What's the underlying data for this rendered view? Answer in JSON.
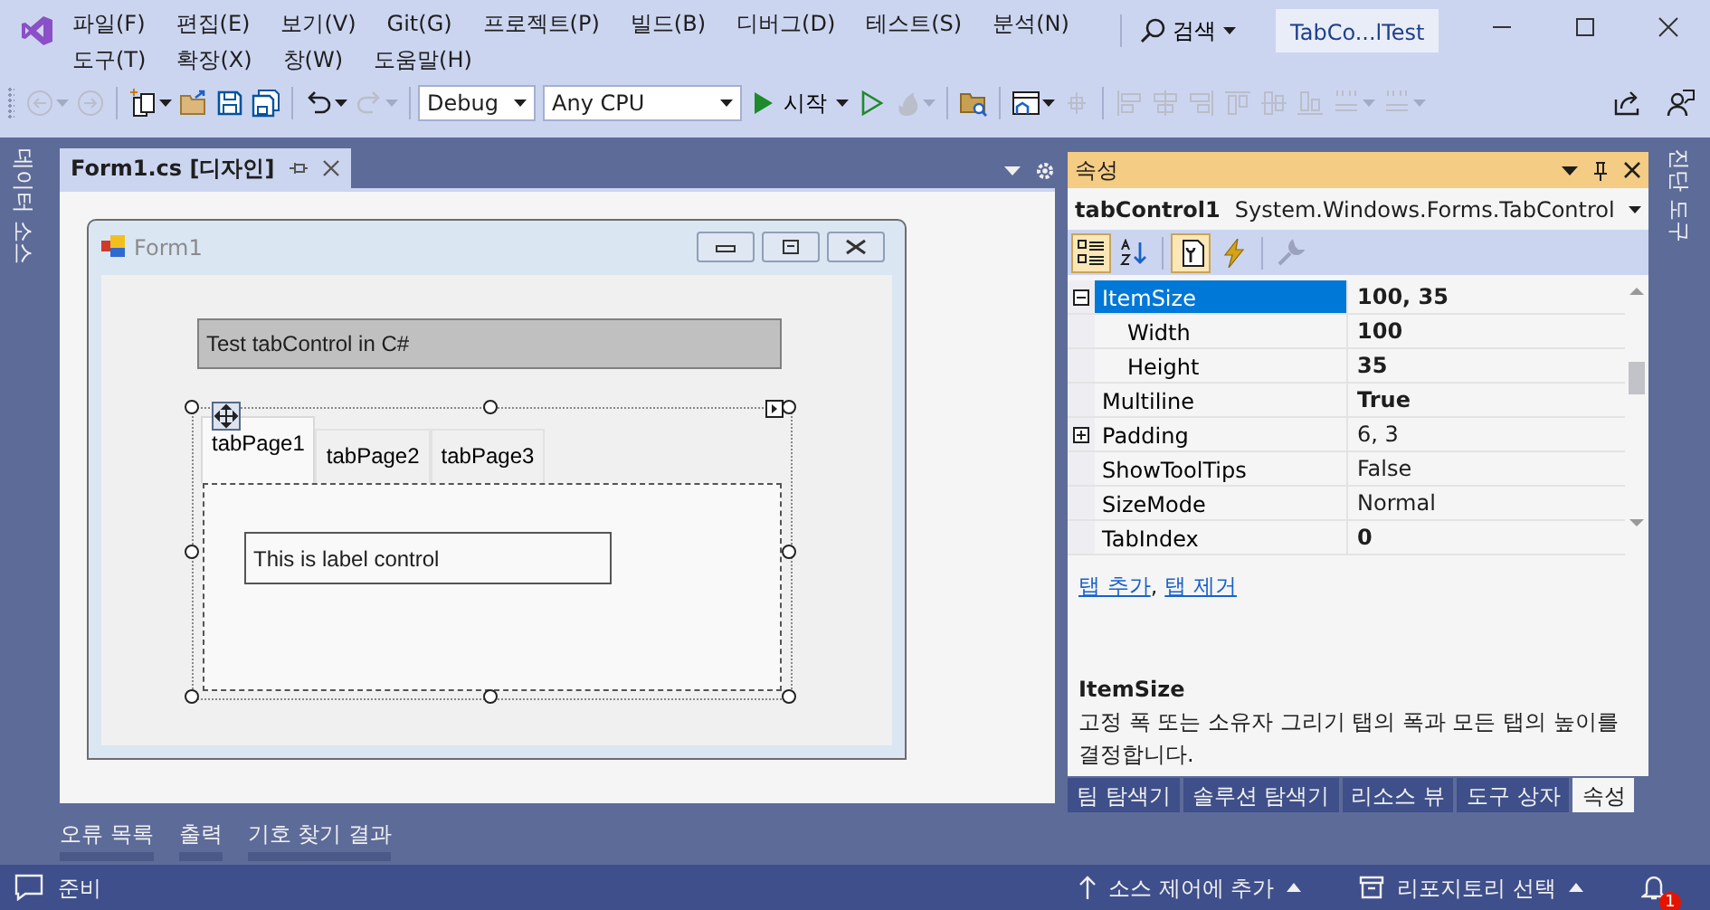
{
  "menu": [
    "파일(F)",
    "편집(E)",
    "보기(V)",
    "Git(G)",
    "프로젝트(P)",
    "빌드(B)",
    "디버그(D)",
    "테스트(S)",
    "분석(N)",
    "도구(T)",
    "확장(X)",
    "창(W)",
    "도움말(H)"
  ],
  "search": {
    "label": "검색"
  },
  "window": {
    "title": "TabCo...lTest"
  },
  "toolbar": [
    {
      "kind": "back",
      "disabled": true,
      "split": true
    },
    {
      "kind": "forward",
      "disabled": true,
      "split": false
    },
    {
      "kind": "separator"
    },
    {
      "kind": "new-project",
      "disabled": false,
      "split": true
    },
    {
      "kind": "open",
      "disabled": false,
      "split": false
    },
    {
      "kind": "save",
      "disabled": false,
      "split": false
    },
    {
      "kind": "save-all",
      "disabled": false,
      "split": false
    },
    {
      "kind": "separator"
    },
    {
      "kind": "undo",
      "disabled": false,
      "split": true
    },
    {
      "kind": "redo",
      "disabled": true,
      "split": true
    },
    {
      "kind": "separator"
    },
    {
      "kind": "combo",
      "value": "Debug"
    },
    {
      "kind": "combo",
      "value": "Any CPU"
    },
    {
      "kind": "start",
      "label": "시작"
    },
    {
      "kind": "start-outline",
      "disabled": false,
      "split": false
    },
    {
      "kind": "hot-reload",
      "disabled": true,
      "split": true
    },
    {
      "kind": "separator"
    },
    {
      "kind": "folder-search",
      "disabled": false,
      "split": false
    },
    {
      "kind": "separator"
    },
    {
      "kind": "form-layout",
      "disabled": false,
      "split": true
    },
    {
      "kind": "grid-size",
      "disabled": true,
      "split": false
    },
    {
      "kind": "separator"
    },
    {
      "kind": "align-left",
      "disabled": true,
      "split": false
    },
    {
      "kind": "align-center",
      "disabled": true,
      "split": false
    },
    {
      "kind": "align-right",
      "disabled": true,
      "split": false
    },
    {
      "kind": "align-top",
      "disabled": true,
      "split": false
    },
    {
      "kind": "align-middle",
      "disabled": true,
      "split": false
    },
    {
      "kind": "align-bottom",
      "disabled": true,
      "split": false
    },
    {
      "kind": "spacing",
      "disabled": true,
      "split": true
    },
    {
      "kind": "spacing",
      "disabled": true,
      "split": true
    },
    {
      "kind": "spacer"
    },
    {
      "kind": "share",
      "disabled": false,
      "split": false
    },
    {
      "kind": "feedback",
      "disabled": false,
      "split": false
    }
  ],
  "side_tabs_left": [
    {
      "label": "데이터 소스"
    }
  ],
  "document_tabs": [
    {
      "label": "Form1.cs [디자인]",
      "selected": true
    }
  ],
  "designer": {
    "form_title": "Form1",
    "title_label": "Test tabControl in C#",
    "tabs": [
      {
        "label": "tabPage1",
        "selected": true
      },
      {
        "label": "tabPage2",
        "selected": false
      },
      {
        "label": "tabPage3",
        "selected": false
      }
    ],
    "page_label": "This is label control"
  },
  "properties": {
    "title": "속성",
    "object_name": "tabControl1",
    "object_type": "System.Windows.Forms.TabControl",
    "toolbar": [
      {
        "kind": "categorized",
        "selected": true,
        "disabled": false
      },
      {
        "kind": "alphabetical",
        "selected": false,
        "disabled": false
      },
      {
        "kind": "properties",
        "selected": true,
        "disabled": false
      },
      {
        "kind": "events",
        "selected": false,
        "disabled": false
      },
      {
        "kind": "property-pages",
        "selected": false,
        "disabled": true
      }
    ],
    "rows": [
      {
        "name": "ItemSize",
        "value": "100, 35",
        "bold": true,
        "selected": true,
        "expanded": true,
        "children": [
          {
            "name": "Width",
            "value": "100",
            "bold": true,
            "selected": false
          },
          {
            "name": "Height",
            "value": "35",
            "bold": true,
            "selected": false
          }
        ]
      },
      {
        "name": "Multiline",
        "value": "True",
        "bold": true,
        "selected": false
      },
      {
        "name": "Padding",
        "value": "6, 3",
        "bold": false,
        "selected": false,
        "expanded": false
      },
      {
        "name": "ShowToolTips",
        "value": "False",
        "bold": false,
        "selected": false
      },
      {
        "name": "SizeMode",
        "value": "Normal",
        "bold": false,
        "selected": false
      },
      {
        "name": "TabIndex",
        "value": "0",
        "bold": true,
        "selected": false
      }
    ],
    "commands": [
      "탭 추가",
      "탭 제거"
    ],
    "command_separator": ",",
    "description": {
      "title": "ItemSize",
      "text": "고정 폭 또는 소유자 그리기 탭의 폭과 모든 탭의 높이를 결정합니다."
    }
  },
  "panel_tabs": [
    {
      "label": "팀 탐색기",
      "selected": false
    },
    {
      "label": "솔루션 탐색기",
      "selected": false
    },
    {
      "label": "리소스 뷰",
      "selected": false
    },
    {
      "label": "도구 상자",
      "selected": false
    },
    {
      "label": "속성",
      "selected": true
    }
  ],
  "tool_tabs": [
    "오류 목록",
    "출력",
    "기호 찾기 결과"
  ],
  "side_tabs_right": [
    {
      "label": "진단 도구"
    }
  ],
  "status_bar": {
    "text": "준비",
    "source_control": "소스 제어에 추가",
    "repository": "리포지토리 선택",
    "notifications": "1"
  }
}
